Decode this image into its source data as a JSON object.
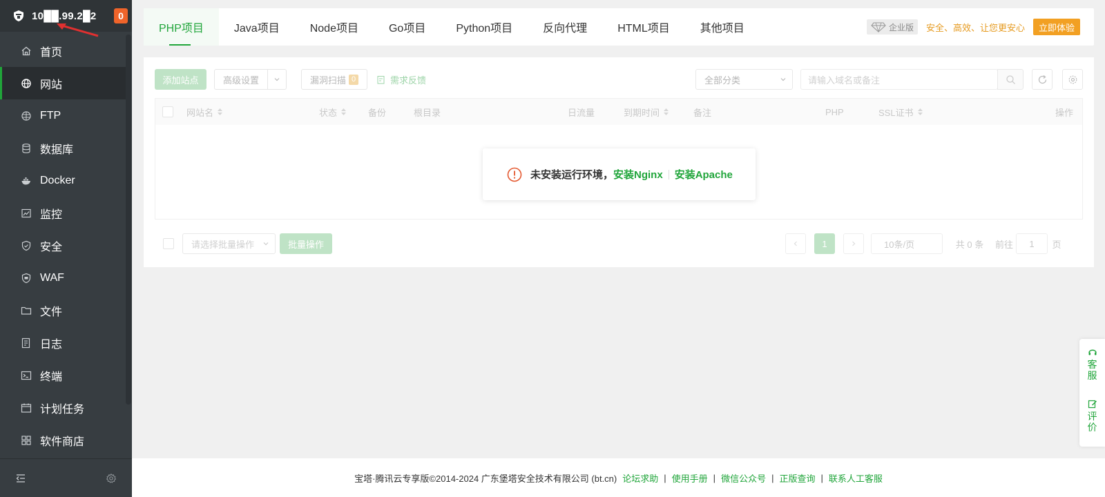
{
  "sidebar": {
    "server_ip": "10██.99.2█2",
    "alert_count": "0",
    "items": [
      {
        "label": "首页",
        "icon": "home-icon"
      },
      {
        "label": "网站",
        "icon": "globe-icon"
      },
      {
        "label": "FTP",
        "icon": "ftp-icon"
      },
      {
        "label": "数据库",
        "icon": "database-icon"
      },
      {
        "label": "Docker",
        "icon": "docker-icon"
      },
      {
        "label": "监控",
        "icon": "monitor-icon"
      },
      {
        "label": "安全",
        "icon": "shield-icon"
      },
      {
        "label": "WAF",
        "icon": "waf-icon"
      },
      {
        "label": "文件",
        "icon": "folder-icon"
      },
      {
        "label": "日志",
        "icon": "log-icon"
      },
      {
        "label": "终端",
        "icon": "terminal-icon"
      },
      {
        "label": "计划任务",
        "icon": "calendar-icon"
      },
      {
        "label": "软件商店",
        "icon": "grid-icon"
      }
    ],
    "active_index": 1
  },
  "tabs": [
    "PHP项目",
    "Java项目",
    "Node项目",
    "Go项目",
    "Python项目",
    "反向代理",
    "HTML项目",
    "其他项目"
  ],
  "enterprise": {
    "tag": "企业版",
    "slogan": "安全、高效、让您更安心",
    "button": "立即体验"
  },
  "toolbar": {
    "add_site": "添加站点",
    "advanced": "高级设置",
    "vuln_scan": "漏洞扫描",
    "vuln_count": "0",
    "feedback": "需求反馈",
    "category": "全部分类",
    "search_placeholder": "请输入域名或备注"
  },
  "table": {
    "headers": [
      "网站名",
      "状态",
      "备份",
      "根目录",
      "日流量",
      "到期时间",
      "备注",
      "PHP",
      "SSL证书",
      "操作"
    ]
  },
  "toast": {
    "message": "未安装运行环境，",
    "link1": "安装Nginx",
    "link2": "安装Apache"
  },
  "bulk": {
    "select_placeholder": "请选择批量操作",
    "button": "批量操作"
  },
  "pagination": {
    "current_page": "1",
    "page_size": "10条/页",
    "total": "共 0 条",
    "goto_prefix": "前往",
    "goto_value": "1",
    "goto_suffix": "页"
  },
  "float_service": {
    "service": "客服",
    "review": "评价"
  },
  "footer": {
    "copyright": "宝塔·腾讯云专享版©2014-2024 广东堡塔安全技术有限公司 (bt.cn)",
    "links": [
      "论坛求助",
      "使用手册",
      "微信公众号",
      "正版查询",
      "联系人工客服"
    ]
  },
  "colors": {
    "accent": "#20a53a",
    "sidebar_bg": "#373d41",
    "badge": "#f0642a",
    "enterprise": "#f2a023"
  }
}
